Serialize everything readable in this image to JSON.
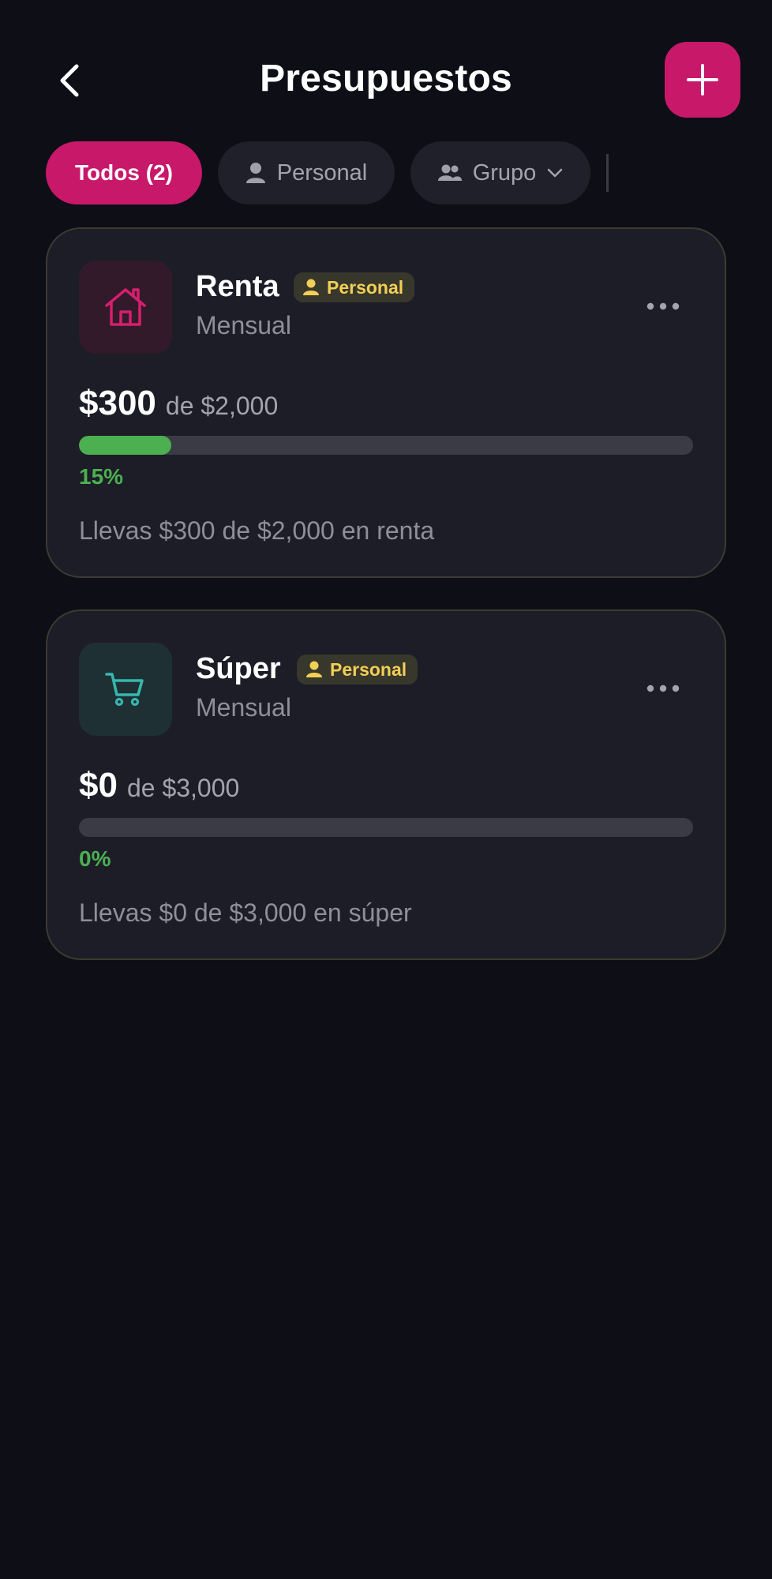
{
  "header": {
    "title": "Presupuestos",
    "back_icon": "chevron-left-icon",
    "add_icon": "plus-icon",
    "accent_color": "#c8186a"
  },
  "filters": {
    "items": [
      {
        "label": "Todos (2)",
        "active": true
      },
      {
        "label": "Personal",
        "icon": "person-icon",
        "active": false
      },
      {
        "label": "Grupo",
        "icon": "group-icon",
        "dropdown": true,
        "active": false
      }
    ]
  },
  "budgets": [
    {
      "name": "Renta",
      "badge": "Personal",
      "period": "Mensual",
      "icon": "house-icon",
      "icon_color": "#d61f6e",
      "spent": "$300",
      "total_text": "de $2,000",
      "progress": 0.15,
      "percent_label": "15%",
      "summary": "Llevas $300 de $2,000 en renta"
    },
    {
      "name": "Súper",
      "badge": "Personal",
      "period": "Mensual",
      "icon": "cart-icon",
      "icon_color": "#36b8b0",
      "spent": "$0",
      "total_text": "de $3,000",
      "progress": 0,
      "percent_label": "0%",
      "summary": "Llevas $0 de $3,000 en súper"
    }
  ],
  "colors": {
    "background": "#0d0e16",
    "card": "#1c1d27",
    "progress_fill": "#4cb051",
    "badge_text": "#f2cf55"
  }
}
